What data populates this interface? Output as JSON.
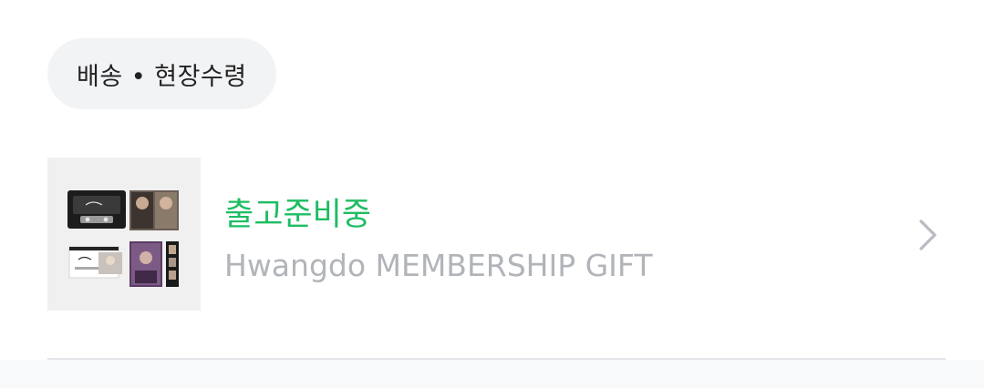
{
  "filter_chip": {
    "label": "배송 • 현장수령"
  },
  "order": {
    "status": "출고준비중",
    "product_name": "Hwangdo MEMBERSHIP GIFT",
    "status_color": "#1ebd62",
    "thumbnail_icon": "product-photo-icon",
    "action_icon": "chevron-right-icon"
  }
}
